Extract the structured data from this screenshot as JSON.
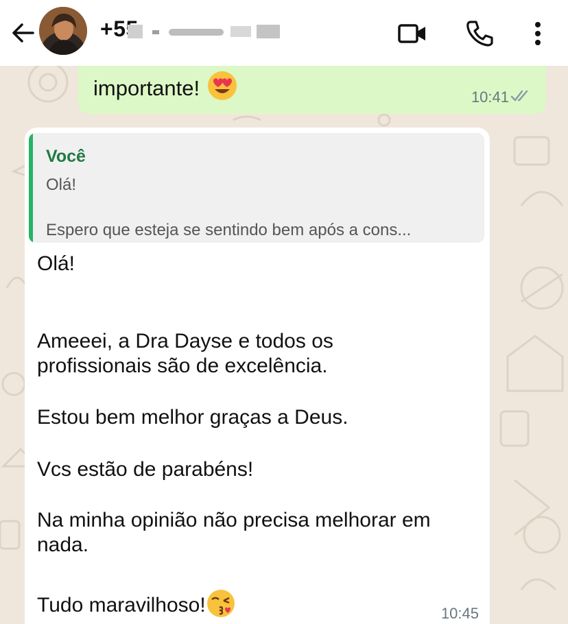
{
  "header": {
    "contact_name": "+55",
    "icons": [
      "back-arrow-icon",
      "video-call-icon",
      "phone-icon",
      "more-vertical-icon"
    ]
  },
  "messages": {
    "outgoing": {
      "text": "importante!",
      "emoji": "heart-eyes-emoji",
      "time": "10:41",
      "status_icon": "double-check-icon"
    },
    "incoming": {
      "quote": {
        "author": "Você",
        "line1": "Olá!",
        "line2": "Espero que esteja se sentindo bem após a cons..."
      },
      "lines": [
        "Olá!",
        "Ameeei, a Dra Dayse e todos os",
        "profissionais são de excelência.",
        "Estou bem melhor graças a Deus.",
        "Vcs estão de parabéns!",
        "Na minha opinião não precisa melhorar  em",
        "nada.",
        "Tudo maravilhoso!"
      ],
      "end_emoji": "kissing-heart-emoji",
      "time": "10:45"
    }
  },
  "colors": {
    "outgoing_bubble": "#dcf8c6",
    "incoming_bubble": "#ffffff",
    "quote_accent": "#25b366",
    "quote_author": "#1f7a45",
    "wallpaper": "#efe7dc"
  }
}
